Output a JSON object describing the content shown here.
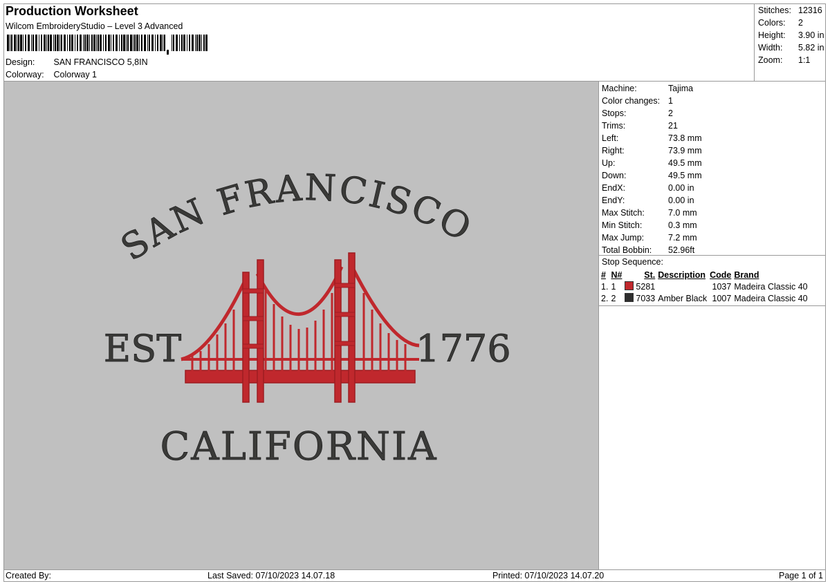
{
  "header": {
    "title": "Production Worksheet",
    "software": "Wilcom EmbroideryStudio – Level 3 Advanced",
    "design_label": "Design:",
    "design_value": "SAN FRANCISCO 5,8IN",
    "colorway_label": "Colorway:",
    "colorway_value": "Colorway 1"
  },
  "summary": [
    {
      "label": "Stitches:",
      "value": "12316"
    },
    {
      "label": "Colors:",
      "value": "2"
    },
    {
      "label": "Height:",
      "value": "3.90 in"
    },
    {
      "label": "Width:",
      "value": "5.82 in"
    },
    {
      "label": "Zoom:",
      "value": "1:1"
    }
  ],
  "design_text": {
    "top_arc": "SAN FRANCISCO",
    "left": "EST",
    "right": "1776",
    "bottom": "CALIFORNIA"
  },
  "colors": {
    "canvas": "#c0c0c0",
    "thread_red": "#c0282d",
    "thread_black": "#3a3a38"
  },
  "machine": [
    {
      "label": "Machine:",
      "value": "Tajima"
    },
    {
      "label": "Color changes:",
      "value": "1"
    },
    {
      "label": "Stops:",
      "value": "2"
    },
    {
      "label": "Trims:",
      "value": "21"
    },
    {
      "label": "Left:",
      "value": "73.8 mm"
    },
    {
      "label": "Right:",
      "value": "73.9 mm"
    },
    {
      "label": "Up:",
      "value": "49.5 mm"
    },
    {
      "label": "Down:",
      "value": "49.5 mm"
    },
    {
      "label": "EndX:",
      "value": "0.00 in"
    },
    {
      "label": "EndY:",
      "value": "0.00 in"
    },
    {
      "label": "Max Stitch:",
      "value": "7.0 mm"
    },
    {
      "label": "Min Stitch:",
      "value": "0.3 mm"
    },
    {
      "label": "Max Jump:",
      "value": "7.2 mm"
    },
    {
      "label": "Total Bobbin:",
      "value": "52.96ft"
    }
  ],
  "stop_sequence": {
    "title": "Stop Sequence:",
    "headers": {
      "num": "#",
      "n": "N#",
      "st": "St.",
      "description": "Description",
      "code": "Code",
      "brand": "Brand"
    },
    "rows": [
      {
        "num": "1.",
        "n": "1",
        "color": "#c0282d",
        "st": "5281",
        "description": "",
        "code": "1037",
        "brand": "Madeira Classic 40"
      },
      {
        "num": "2.",
        "n": "2",
        "color": "#2e2e2e",
        "st": "7033",
        "description": "Amber Black",
        "code": "1007",
        "brand": "Madeira Classic 40"
      }
    ]
  },
  "footer": {
    "created_by": "Created By:",
    "last_saved": "Last Saved: 07/10/2023 14.07.18",
    "printed": "Printed: 07/10/2023 14.07.20",
    "page": "Page 1 of 1"
  }
}
